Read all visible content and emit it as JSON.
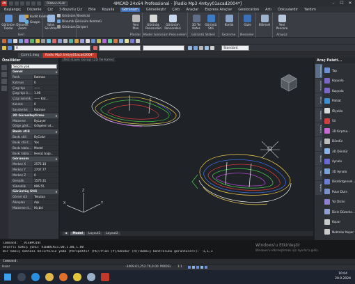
{
  "window": {
    "title": "4MCAD 24x64 Professional - [Radio Mp3 4mtyy01acad2004*]",
    "ribbon_toggle": "Ribbon Kullr",
    "app_icon": "4M"
  },
  "menu_tabs": [
    "Başlangıç",
    "Düzenle",
    "Çiz",
    "3-Boyutlu Çiz",
    "Ekle",
    "Koyalla",
    "Görünüm",
    "Görselleştir",
    "Çıktı",
    "Araçlar",
    "Express Araçlar",
    "Geolocation",
    "Artı",
    "Dokuulardır",
    "Yardım"
  ],
  "active_menu_tab": "Görünüm",
  "ribbon": {
    "groups": [
      {
        "label": "Geri",
        "buttons": [
          "Görünüm Tazele",
          "Dinamik Zoom",
          "Geçiş"
        ]
      },
      {
        "label": "",
        "buttons": [
          "Yakın Sol Arka"
        ]
      },
      {
        "label": "",
        "small": [
          "Görünüm Yöneticisi",
          "Dinamik Görünüm Kontrolü",
          "Görünüm Girişleri"
        ]
      },
      {
        "label": "Planlar",
        "buttons": [
          "Yeni Plan"
        ]
      },
      {
        "label": "Model Görünüm Pencereleri",
        "buttons": [
          "Görünüş Pencereleri",
          "Görünüm Pencereleri"
        ]
      },
      {
        "label": "Görüntü Stilleri",
        "buttons": [
          "3D Tel Kafes",
          "Görüntü Stili"
        ]
      },
      {
        "label": "Gezinme",
        "buttons": [
          "Kimlik"
        ]
      },
      {
        "label": "Nesneler",
        "buttons": [
          "Gizle"
        ]
      },
      {
        "label": "",
        "buttons": [
          "Bilimsel"
        ]
      },
      {
        "label": "Arayüz",
        "buttons": [
          "Yeni Pencere"
        ]
      }
    ],
    "misc": {
      "group_label_right": "Nesneler",
      "extra_small": [
        "Kodlit Kırılmaş",
        "Gezgin"
      ]
    }
  },
  "toolbar": {
    "layer_value": "0",
    "style_value": "Standard"
  },
  "doc_tabs": [
    "Çizim1.dwg",
    "Radio Mp3 4mtyy01acad2004*"
  ],
  "active_doc_tab": 1,
  "properties": {
    "title": "Özellikler",
    "selection": "Seçim yok",
    "sections": [
      {
        "name": "Genel",
        "rows": [
          [
            "Renk",
            "Katman"
          ],
          [
            "Katman",
            "0"
          ],
          [
            "Çizgi tipi",
            "——"
          ],
          [
            "Çizgi tipi ö...",
            "1.00"
          ],
          [
            "Çizgi kalınlık...",
            "—— Kat..."
          ],
          [
            "Kalınlık",
            "0"
          ],
          [
            "Saydamlık",
            "Katman"
          ]
        ]
      },
      {
        "name": "3D Görselleştirme",
        "rows": [
          [
            "Malzeme",
            "ByLayer"
          ],
          [
            "Gölge göst...",
            "Gölgeleri at..."
          ]
        ]
      },
      {
        "name": "Baskı stili",
        "rows": [
          [
            "Baskı stili",
            "ByColor"
          ],
          [
            "Baskı stili t...",
            "Yok"
          ],
          [
            "Baskı tablo...",
            "Model"
          ],
          [
            "Baskı tabla...",
            "Henüz bağı..."
          ]
        ]
      },
      {
        "name": "Görünüm",
        "rows": [
          [
            "Merkez X",
            "2575.18"
          ],
          [
            "Merkez Y",
            "2707.77"
          ],
          [
            "Merkez Z",
            "0"
          ],
          [
            "Genişlik",
            "1575.31"
          ],
          [
            "Yükseklik",
            "896.55"
          ]
        ]
      },
      {
        "name": "Görüntüş Stili",
        "rows": [
          [
            "Görsel stil",
            "Tekulaa"
          ],
          [
            "Alkaplan",
            "Aşk"
          ],
          [
            "Malzeme d...",
            "Hiçbiri"
          ]
        ]
      }
    ]
  },
  "canvas": {
    "label": "[Üst] [Izom Görüş] [2D Tel Kafes]"
  },
  "layout_tabs": [
    "Model",
    "Layout1",
    "Layout2"
  ],
  "active_layout_tab": "Model",
  "palette": {
    "title": "Araç Paleti...",
    "tabs": [
      "Modelleme",
      "Açıklama",
      "Mimari",
      "Mekanik",
      "Elektrik",
      "İnşaat",
      "Yapısal",
      "Tablo",
      "Tarama"
    ],
    "items": [
      {
        "label": "Tap",
        "color": "#6c8fd6"
      },
      {
        "label": "Kopyala",
        "color": "#7b68c8"
      },
      {
        "label": "Kopyala",
        "color": "#7b68c8"
      },
      {
        "label": "Pahlat",
        "color": "#3c8fd0"
      },
      {
        "label": "Ölçekle",
        "color": "#d9d9d9"
      },
      {
        "label": "Sil",
        "color": "#d04040"
      },
      {
        "label": "3D Kırpma...",
        "color": "#c76ad1"
      },
      {
        "label": "Döndür",
        "color": "#bdbdbd"
      },
      {
        "label": "3D Döndür",
        "color": "#8ab4e8"
      },
      {
        "label": "Aynala",
        "color": "#6a6ad0"
      },
      {
        "label": "3D Aynala",
        "color": "#7aa4d8"
      },
      {
        "label": "Dikdörtgensel...",
        "color": "#6c7ed0"
      },
      {
        "label": "Polar Dizin",
        "color": "#7b8fc9"
      },
      {
        "label": "Yol Dizini",
        "color": "#8f7fd0"
      },
      {
        "label": "Dizin Düzenle...",
        "color": "#8f9fd0"
      },
      {
        "label": "Kopar",
        "color": "#c9c9c9"
      },
      {
        "label": "Noktalar Kopar",
        "color": "#c9c9c9"
      }
    ]
  },
  "command": {
    "lines": [
      "Command: '_VIEWPOINT",
      "Geçerli bakış yönü: VIEWDIR=1.00,1.00,1.00",
      "Bir bakış noktası belirtiniz yada [Perspektif (PE)/Plan (P)/Döndür (R)/<Bakış kontrolünü görüntüler>]: -1,1,1"
    ],
    "prompt": "Command:"
  },
  "windows_activation": {
    "title": "Windows'u Etkinleştir",
    "subtitle": "Windows'u etkinleştirmek için Ayarlar'a gidin."
  },
  "status": {
    "left": "Hazır",
    "coords": "-3469.61,252.76,0.00",
    "model": "MODEL",
    "scale": "1:1"
  },
  "taskbar": {
    "time": "10:04",
    "date": "20.9.2024"
  },
  "colors": {
    "accent": "#3d6fb6",
    "doc_tab": "#c0392b",
    "cad_yellow": "#e0c24a",
    "cad_green": "#48c24a",
    "cad_blue": "#3d6be0",
    "cad_red": "#d63b3b",
    "cad_magenta": "#b04ad0",
    "cad_white": "#e8e8e8"
  }
}
